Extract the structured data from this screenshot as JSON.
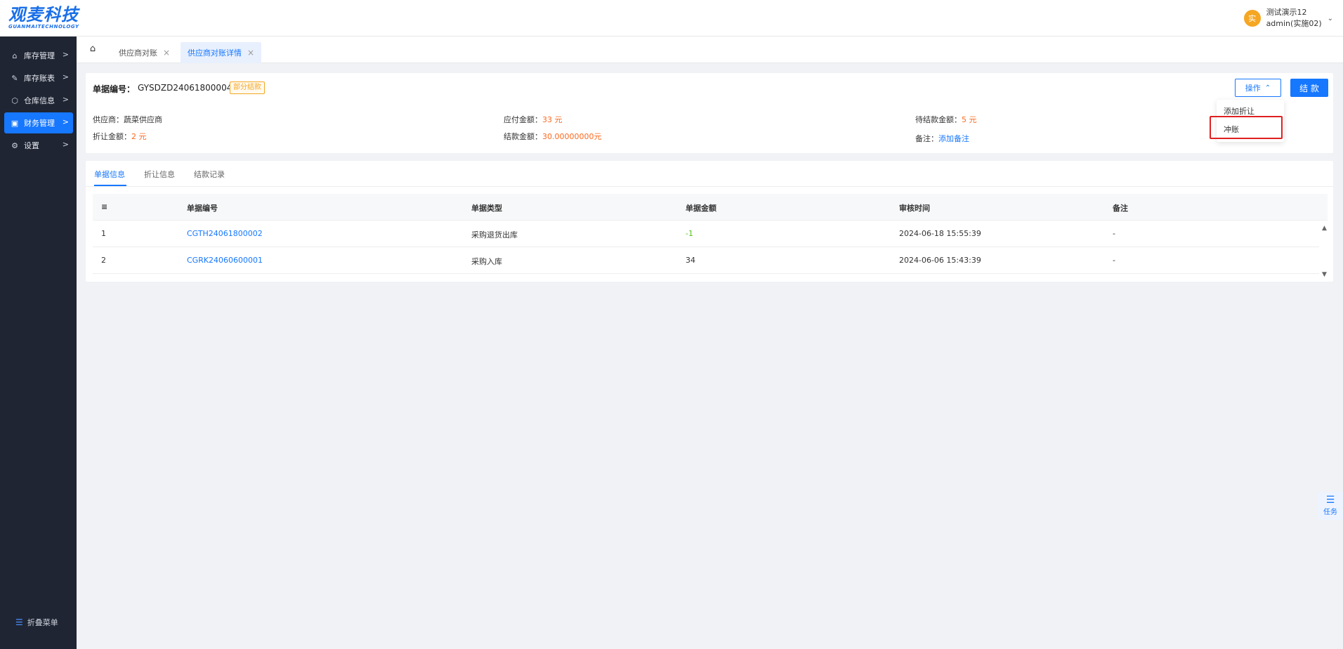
{
  "header": {
    "logo_cn": "观麦科技",
    "logo_en": "GUANMAITECHNOLOGY",
    "user": {
      "avatar_text": "实",
      "name": "测试演示12",
      "account": "admin(实施02)"
    }
  },
  "sidebar": {
    "items": [
      {
        "label": "库存管理"
      },
      {
        "label": "库存账表"
      },
      {
        "label": "仓库信息"
      },
      {
        "label": "财务管理"
      },
      {
        "label": "设置"
      }
    ],
    "collapse_label": "折叠菜单"
  },
  "tabs": [
    {
      "label": "供应商对账"
    },
    {
      "label": "供应商对账详情"
    }
  ],
  "detail": {
    "doc_no_label": "单据编号：",
    "doc_no": "GYSDZD24061800004",
    "status_badge": "部分结款",
    "supplier_label": "供应商：",
    "supplier": "蔬菜供应商",
    "discount_label": "折让金额：",
    "discount": "2 元",
    "payable_label": "应付金额：",
    "payable": "33 元",
    "settled_label": "结款金额：",
    "settled": "30.00000000元",
    "pending_label": "待结款金额：",
    "pending": "5 元",
    "remark_label": "备注：",
    "remark_link": "添加备注",
    "op_button": "操作",
    "settle_button": "结 款"
  },
  "dropdown": {
    "items": [
      "添加折让",
      "冲账"
    ]
  },
  "subtabs": [
    "单据信息",
    "折让信息",
    "结款记录"
  ],
  "table": {
    "headers": [
      "单据编号",
      "单据类型",
      "单据金额",
      "审核时间",
      "备注"
    ],
    "rows": [
      {
        "idx": "1",
        "no": "CGTH24061800002",
        "type": "采购退货出库",
        "amount": "-1",
        "time": "2024-06-18 15:55:39",
        "remark": "-"
      },
      {
        "idx": "2",
        "no": "CGRK24060600001",
        "type": "采购入库",
        "amount": "34",
        "time": "2024-06-06 15:43:39",
        "remark": "-"
      }
    ]
  },
  "task_label": "任务",
  "colors": {
    "primary": "#1677ff",
    "sidebar": "#1f2533",
    "warning": "#f5a623",
    "amount_orange": "#fa6a1f",
    "negative_green": "#52c41a",
    "highlight_red": "#e02020"
  }
}
